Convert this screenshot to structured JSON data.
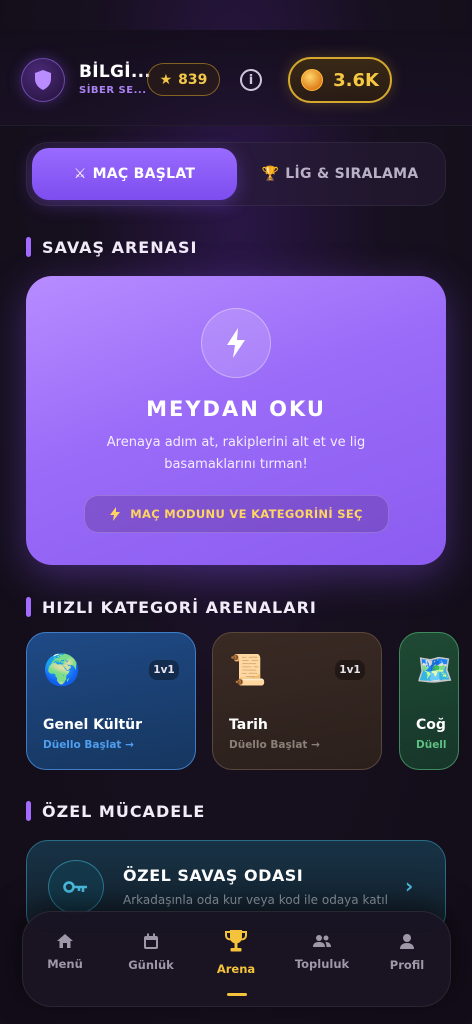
{
  "header": {
    "username": "BİLGİ...",
    "rank": "SİBER SE...",
    "stars": "839",
    "coins": "3.6K"
  },
  "tabs": [
    {
      "icon": "crossed-swords-icon",
      "label": "MAÇ BAŞLAT",
      "active": true
    },
    {
      "icon": "trophy-icon",
      "label": "LİG & SIRALAMA",
      "active": false
    }
  ],
  "sections": {
    "arena": "SAVAŞ ARENASI",
    "quick": "HIZLI KATEGORİ ARENALARI",
    "special": "ÖZEL MÜCADELE"
  },
  "hero": {
    "title": "MEYDAN OKU",
    "desc_line1": "Arenaya adım at, rakiplerini alt et ve lig",
    "desc_line2": "basamaklarını tırman!",
    "button": "MAÇ MODUNU VE KATEGORİNİ SEÇ"
  },
  "categories": [
    {
      "emoji": "🌍",
      "badge": "1v1",
      "name": "Genel Kültür",
      "link": "Düello Başlat →"
    },
    {
      "emoji": "📜",
      "badge": "1v1",
      "name": "Tarih",
      "link": "Düello Başlat →"
    },
    {
      "emoji": "🗺️",
      "badge": "",
      "name": "Coğ",
      "link": "Düell"
    }
  ],
  "room": {
    "title": "ÖZEL SAVAŞ ODASI",
    "subtitle": "Arkadaşınla oda kur veya kod ile odaya katıl"
  },
  "nav": [
    {
      "icon": "home-icon",
      "label": "Menü"
    },
    {
      "icon": "calendar-icon",
      "label": "Günlük"
    },
    {
      "icon": "trophy-icon",
      "label": "Arena",
      "active": true
    },
    {
      "icon": "people-icon",
      "label": "Topluluk"
    },
    {
      "icon": "person-icon",
      "label": "Profil"
    }
  ],
  "colors": {
    "accent": "#9a6bff",
    "gold": "#f5c33b",
    "background": "#17101f"
  }
}
